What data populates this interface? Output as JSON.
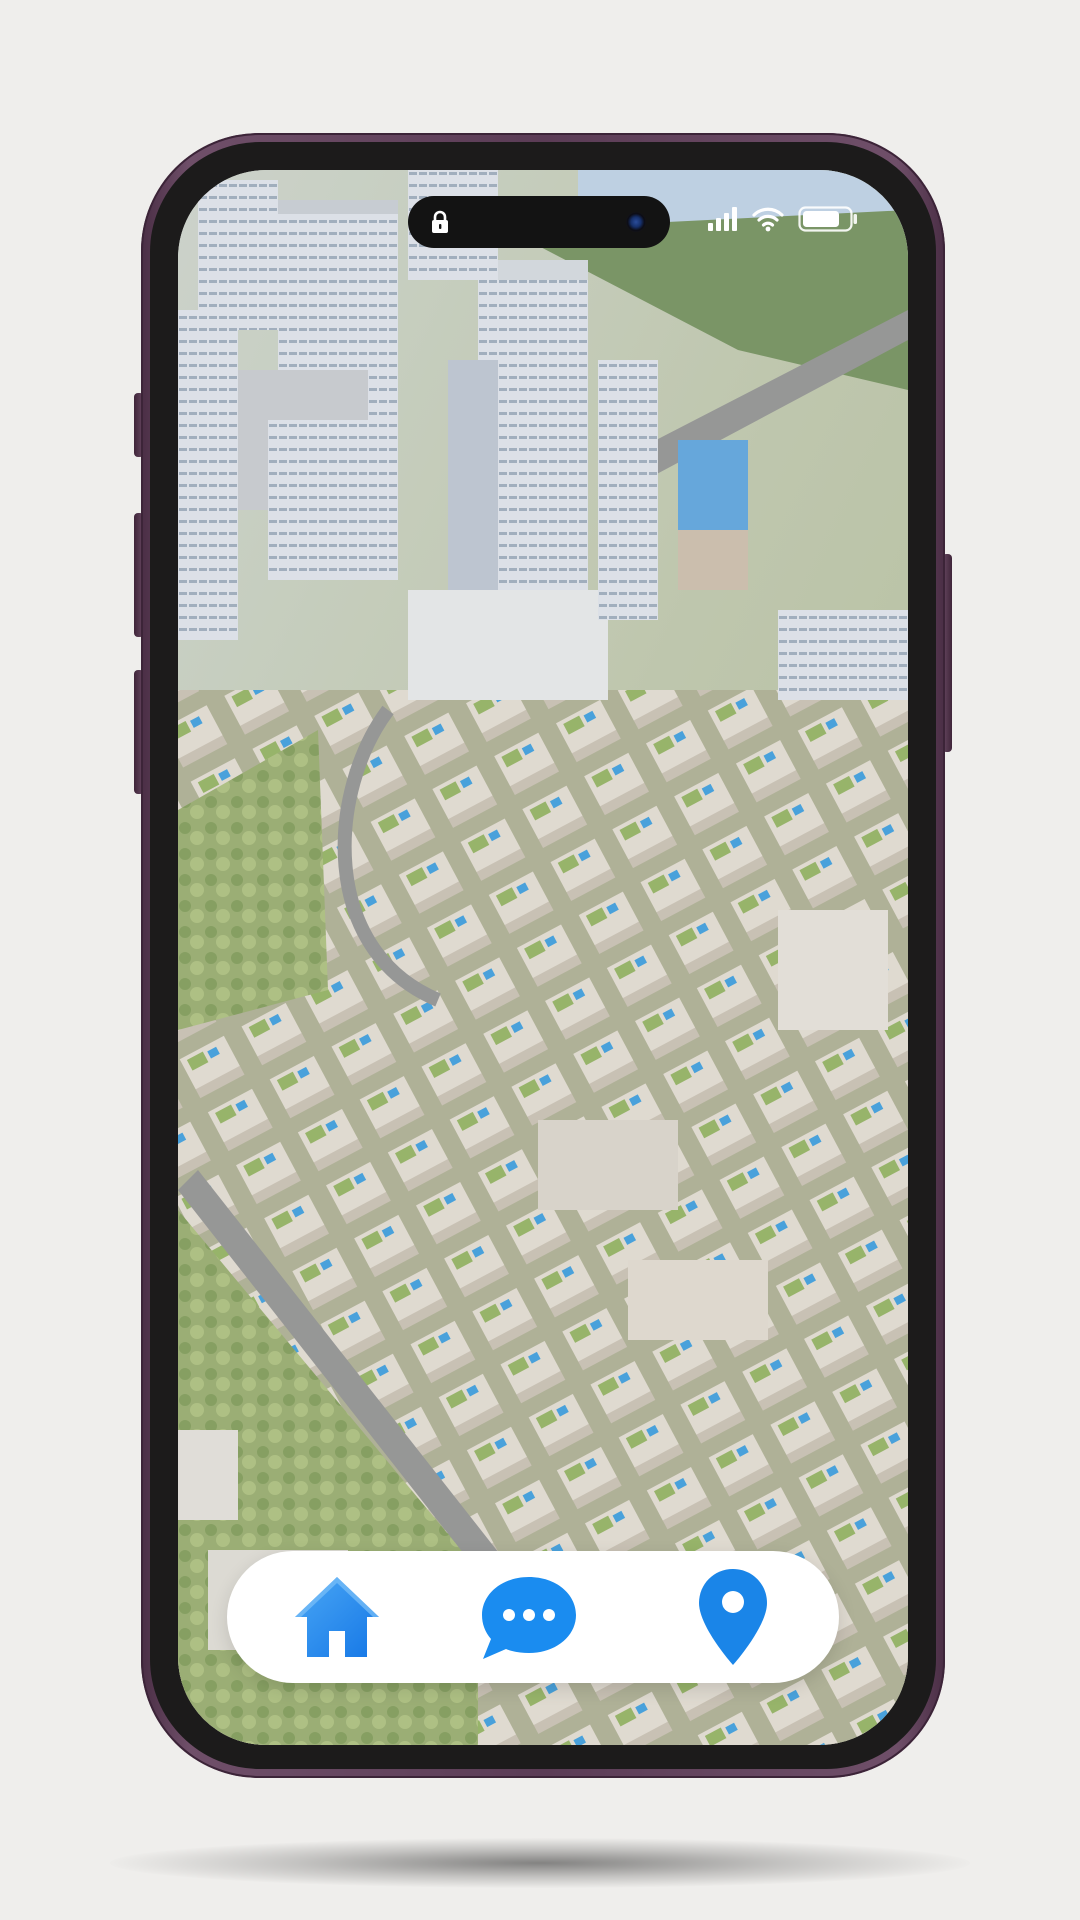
{
  "device": {
    "frame_color": "#5b3c56",
    "bezel_color": "#1c1b1b"
  },
  "status_bar": {
    "lock_icon": "lock-icon",
    "signal_icon": "cellular-signal-icon",
    "wifi_icon": "wifi-icon",
    "battery_icon": "battery-icon",
    "battery_level": 0.8
  },
  "wallpaper": {
    "subject": "aerial-city-view"
  },
  "tabbar": {
    "accent_color": "#1a8cf0",
    "tabs": [
      {
        "id": "home",
        "icon": "house-icon"
      },
      {
        "id": "chat",
        "icon": "chat-bubble-icon"
      },
      {
        "id": "map",
        "icon": "location-pin-icon"
      }
    ]
  }
}
